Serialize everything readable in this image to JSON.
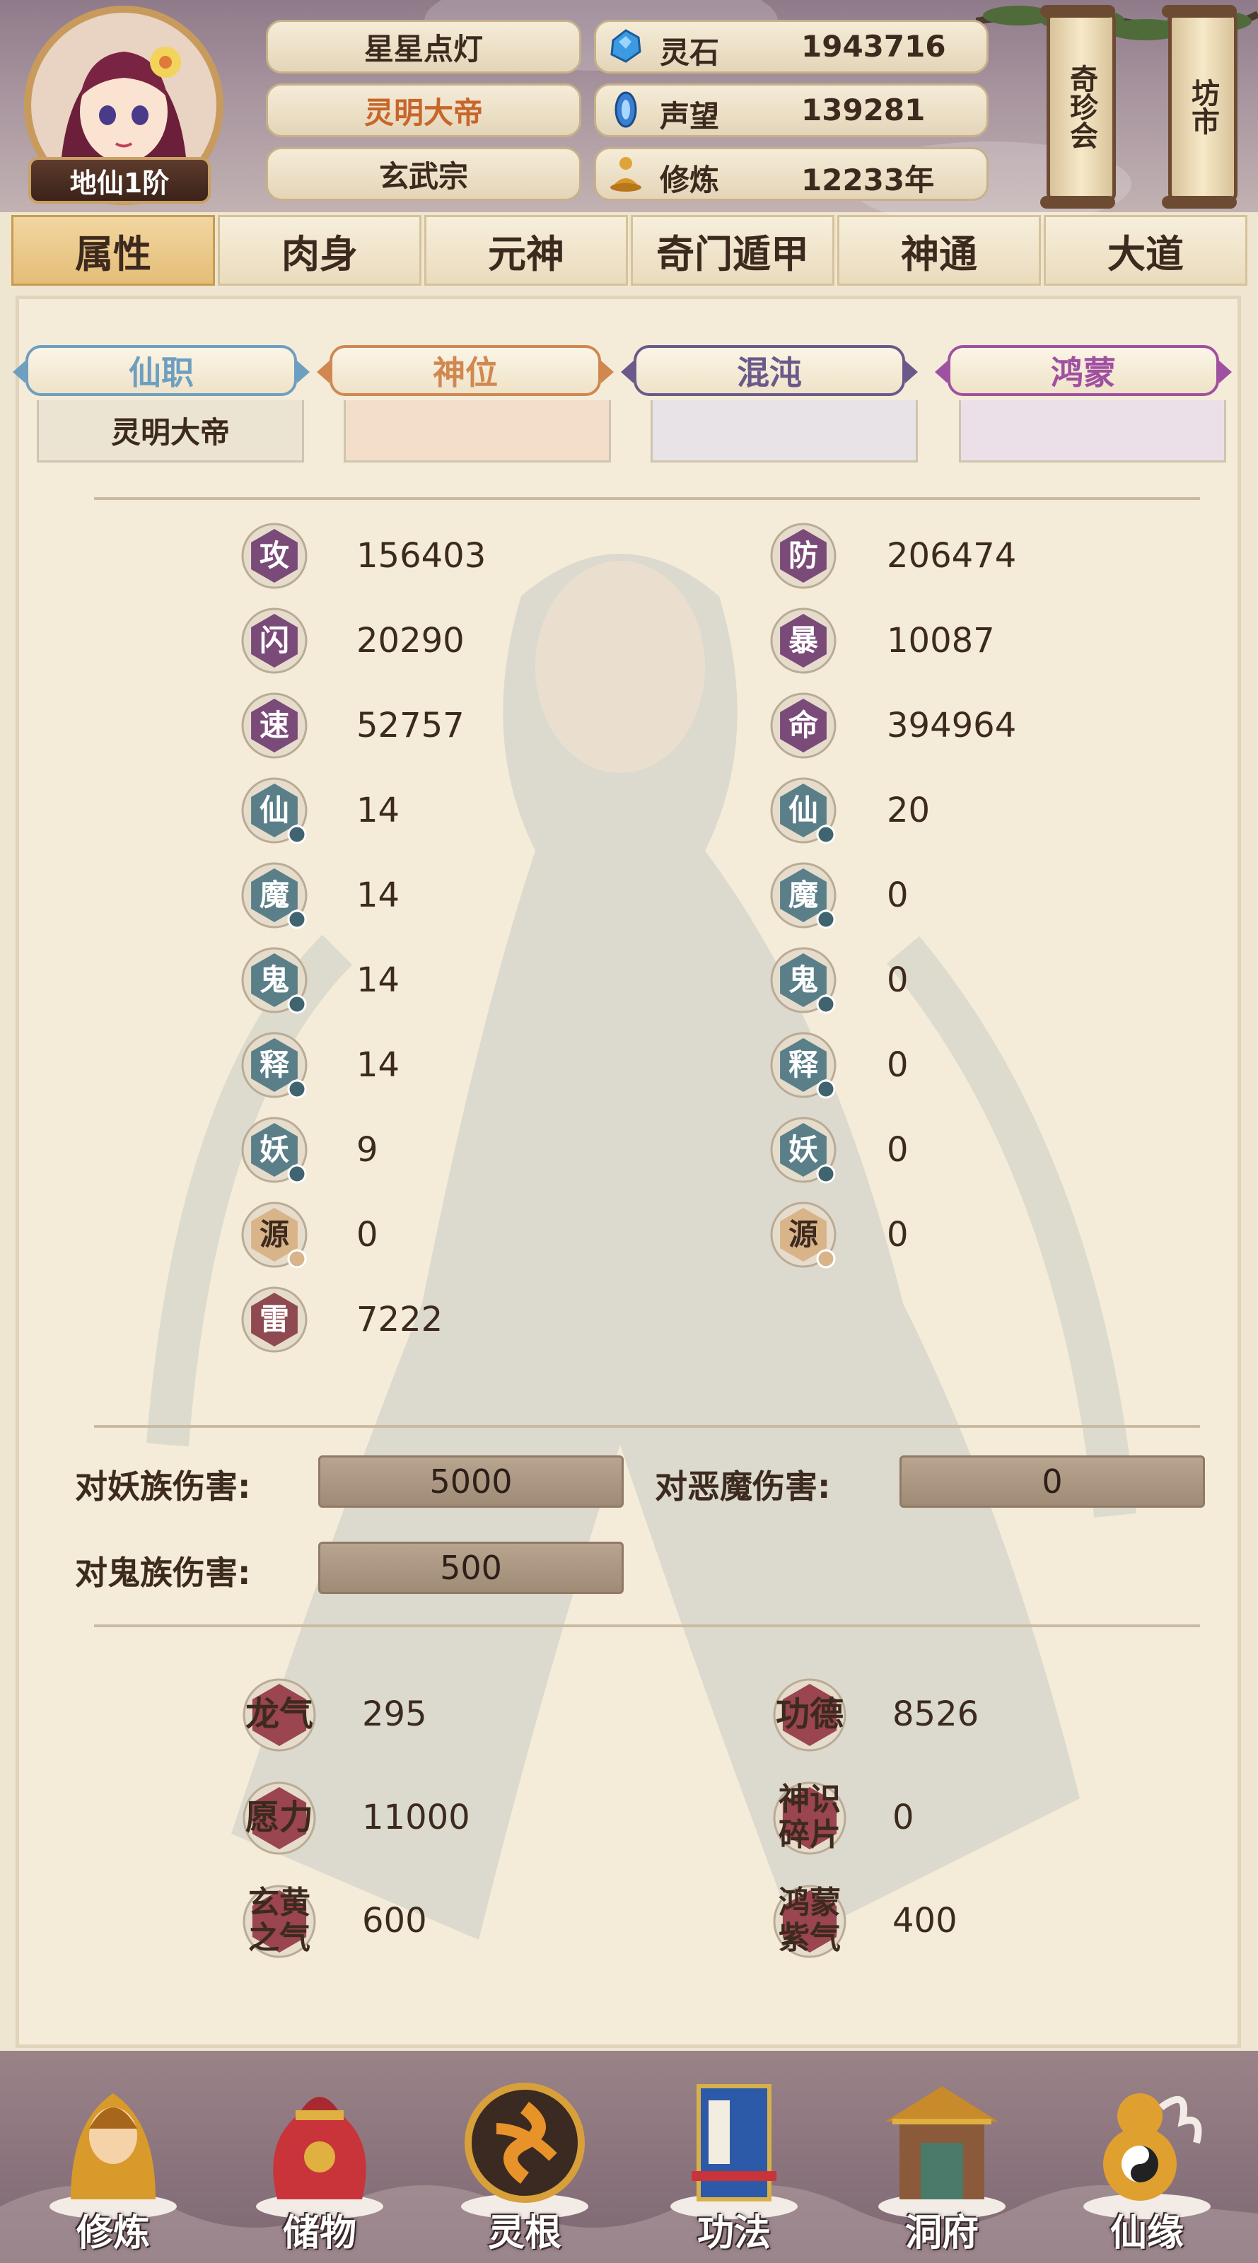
{
  "player": {
    "rank": "地仙1阶",
    "name": "星星点灯",
    "title": "灵明大帝",
    "sect": "玄武宗"
  },
  "resources": [
    {
      "icon": "spirit-stone-icon",
      "label": "灵石",
      "value": "1943716"
    },
    {
      "icon": "prestige-icon",
      "label": "声望",
      "value": "139281"
    },
    {
      "icon": "cultivation-icon",
      "label": "修炼",
      "value": "12233年"
    }
  ],
  "scrolls": {
    "treasure_fair": "奇珍会",
    "market": "坊市"
  },
  "tabs": [
    "属性",
    "肉身",
    "元神",
    "奇门遁甲",
    "神通",
    "大道"
  ],
  "active_tab": "属性",
  "positions": {
    "headers": [
      "仙职",
      "神位",
      "混沌",
      "鸿蒙"
    ],
    "header_colors": [
      "#6f9fc0",
      "#d08850",
      "#6a5a8a",
      "#a050a0"
    ],
    "values": [
      "灵明大帝",
      "",
      "",
      ""
    ]
  },
  "stats": {
    "left": [
      {
        "icon": "攻",
        "value": "156403"
      },
      {
        "icon": "闪",
        "value": "20290"
      },
      {
        "icon": "速",
        "value": "52757"
      },
      {
        "icon": "仙",
        "value": "14"
      },
      {
        "icon": "魔",
        "value": "14"
      },
      {
        "icon": "鬼",
        "value": "14"
      },
      {
        "icon": "释",
        "value": "14"
      },
      {
        "icon": "妖",
        "value": "9"
      },
      {
        "icon": "源",
        "value": "0"
      },
      {
        "icon": "雷",
        "value": "7222"
      }
    ],
    "right": [
      {
        "icon": "防",
        "value": "206474"
      },
      {
        "icon": "暴",
        "value": "10087"
      },
      {
        "icon": "命",
        "value": "394964"
      },
      {
        "icon": "仙",
        "value": "20"
      },
      {
        "icon": "魔",
        "value": "0"
      },
      {
        "icon": "鬼",
        "value": "0"
      },
      {
        "icon": "释",
        "value": "0"
      },
      {
        "icon": "妖",
        "value": "0"
      },
      {
        "icon": "源",
        "value": "0"
      }
    ]
  },
  "damage": {
    "vs_demon_race_label": "对妖族伤害:",
    "vs_demon_race_value": "5000",
    "vs_devil_label": "对恶魔伤害:",
    "vs_devil_value": "0",
    "vs_ghost_race_label": "对鬼族伤害:",
    "vs_ghost_race_value": "500"
  },
  "misc": [
    {
      "label": "龙气",
      "value": "295"
    },
    {
      "label": "功德",
      "value": "8526"
    },
    {
      "label": "愿力",
      "value": "11000"
    },
    {
      "label": "神识碎片",
      "value": "0"
    },
    {
      "label": "玄黄之气",
      "value": "600"
    },
    {
      "label": "鸿蒙紫气",
      "value": "400"
    }
  ],
  "bottom_nav": [
    "修炼",
    "储物",
    "灵根",
    "功法",
    "洞府",
    "仙缘"
  ],
  "colors": {
    "stat_purple": "#7a4a78",
    "stat_teal": "#5a7f88",
    "stat_tan": "#d9b489",
    "stat_red": "#8e4a50",
    "misc_red": "#9a4550",
    "accent_orange": "#c8652a"
  }
}
